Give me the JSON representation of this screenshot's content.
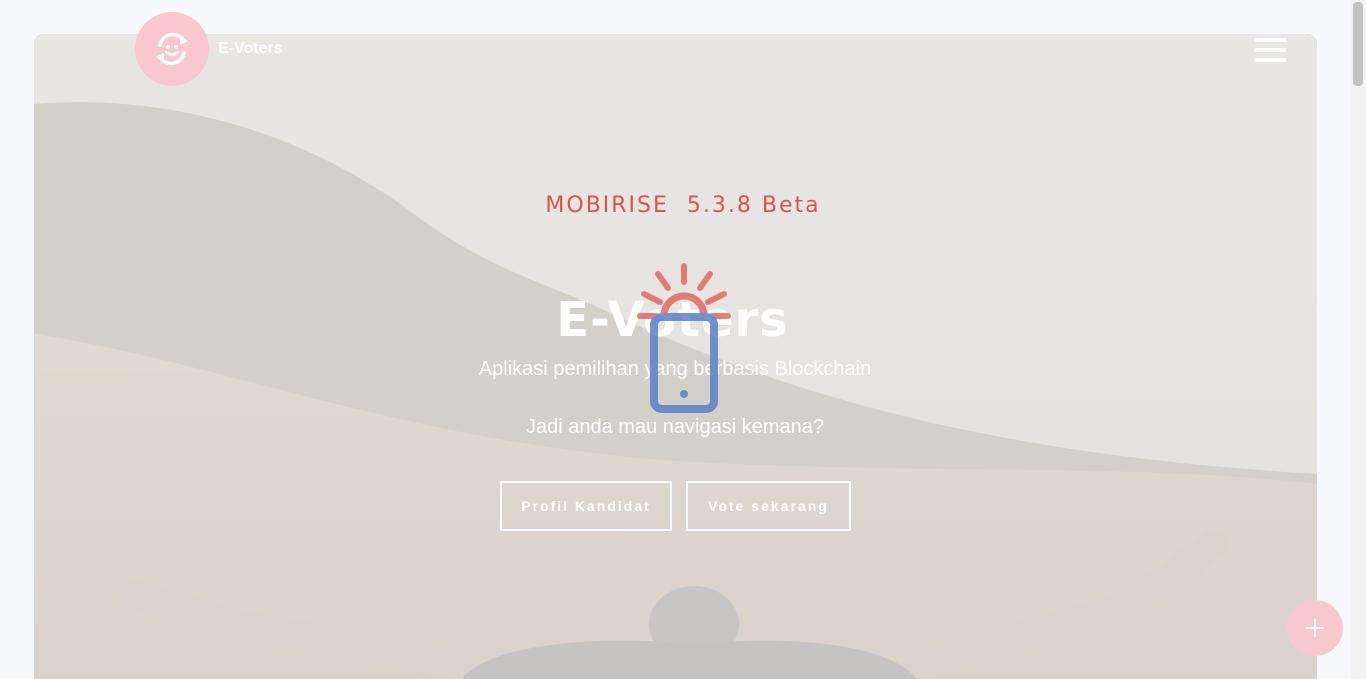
{
  "navbar": {
    "brand": "E-Voters",
    "logo_icon": "refresh-smile-icon",
    "menu_icon": "hamburger-icon"
  },
  "hero": {
    "eyebrow": "MOBIRISE  5.3.8 Beta",
    "title": "E-Voters",
    "subtitle": "Aplikasi pemilihan yang berbasis Blockchain",
    "question": "Jadi anda mau navigasi kemana?",
    "buttons": {
      "profil": "Profil Kandidat",
      "vote": "Vote sekarang"
    }
  },
  "loader": {
    "icon": "phone-sun-icon"
  },
  "fab": {
    "icon": "plus-icon"
  },
  "colors": {
    "accent": "#d9544f",
    "logo_bg": "#f7c9cd",
    "loader_blue": "#5b7fc7",
    "loader_red": "#e06a63"
  }
}
